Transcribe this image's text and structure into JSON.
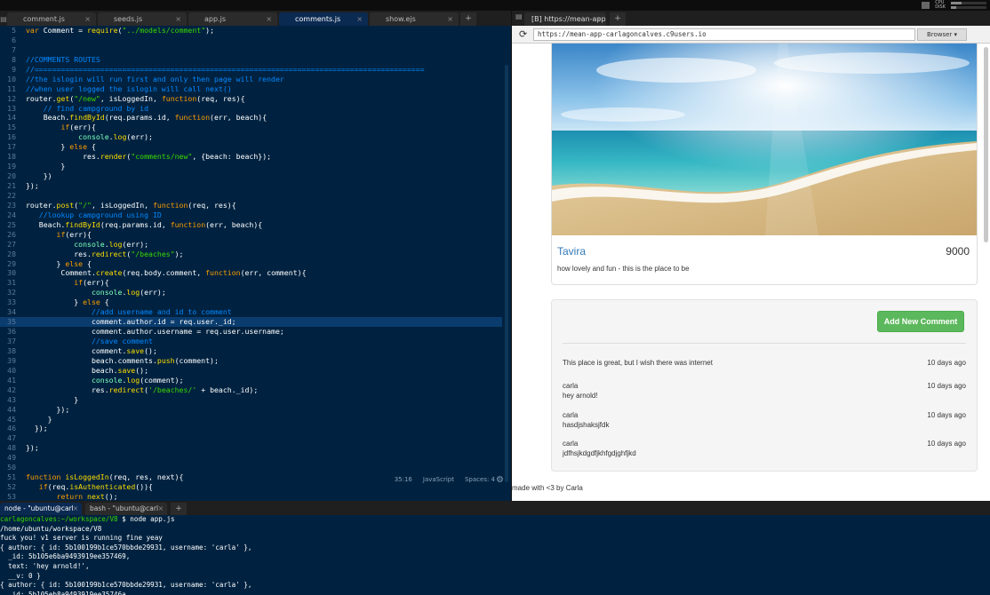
{
  "editor": {
    "tabs": [
      {
        "label": "comment.js",
        "active": false
      },
      {
        "label": "seeds.js",
        "active": false
      },
      {
        "label": "app.js",
        "active": false
      },
      {
        "label": "comments.js",
        "active": true
      },
      {
        "label": "show.ejs",
        "active": false
      }
    ],
    "add_tab": "+",
    "close_glyph": "×",
    "lines": [
      {
        "n": "5",
        "html": "<span class='kw'>var</span> Comment = <span class='fn'>require</span>(<span class='str'>\"../models/comment\"</span>);"
      },
      {
        "n": "6",
        "html": ""
      },
      {
        "n": "7",
        "html": ""
      },
      {
        "n": "8",
        "html": "<span class='cmt'>//COMMENTS ROUTES</span>"
      },
      {
        "n": "9",
        "html": "<span class='cmt'>//=========================================================================================</span>"
      },
      {
        "n": "10",
        "html": "<span class='cmt'>//the islogin will run first and only then page will render</span>"
      },
      {
        "n": "11",
        "html": "<span class='cmt'>//when user logged the islogin will call next()</span>"
      },
      {
        "n": "12",
        "html": "router.<span class='fn'>get</span>(<span class='str'>\"/new\"</span>, isLoggedIn, <span class='kw'>function</span>(req, res){"
      },
      {
        "n": "13",
        "html": "    <span class='cmt'>// find campground by id</span>"
      },
      {
        "n": "14",
        "html": "    Beach.<span class='fn'>findById</span>(req.params.id, <span class='kw'>function</span>(err, beach){"
      },
      {
        "n": "15",
        "html": "        <span class='kw'>if</span>(err){"
      },
      {
        "n": "16",
        "html": "            <span class='obj'>console</span>.<span class='fn'>log</span>(err);"
      },
      {
        "n": "17",
        "html": "        } <span class='kw'>else</span> {"
      },
      {
        "n": "18",
        "html": "             res.<span class='fn'>render</span>(<span class='str'>\"comments/new\"</span>, {beach: beach});"
      },
      {
        "n": "19",
        "html": "        }"
      },
      {
        "n": "20",
        "html": "    })"
      },
      {
        "n": "21",
        "html": "});"
      },
      {
        "n": "22",
        "html": ""
      },
      {
        "n": "23",
        "html": "router.<span class='fn'>post</span>(<span class='str'>\"/\"</span>, isLoggedIn, <span class='kw'>function</span>(req, res){"
      },
      {
        "n": "24",
        "html": "   <span class='cmt'>//lookup campground using ID</span>"
      },
      {
        "n": "25",
        "html": "   Beach.<span class='fn'>findById</span>(req.params.id, <span class='kw'>function</span>(err, beach){"
      },
      {
        "n": "26",
        "html": "       <span class='kw'>if</span>(err){"
      },
      {
        "n": "27",
        "html": "           <span class='obj'>console</span>.<span class='fn'>log</span>(err);"
      },
      {
        "n": "28",
        "html": "           res.<span class='fn'>redirect</span>(<span class='str'>\"/beaches\"</span>);"
      },
      {
        "n": "29",
        "html": "       } <span class='kw'>else</span> {"
      },
      {
        "n": "30",
        "html": "        Comment.<span class='fn'>create</span>(req.body.comment, <span class='kw'>function</span>(err, comment){"
      },
      {
        "n": "31",
        "html": "           <span class='kw'>if</span>(err){"
      },
      {
        "n": "32",
        "html": "               <span class='obj'>console</span>.<span class='fn'>log</span>(err);"
      },
      {
        "n": "33",
        "html": "           } <span class='kw'>else</span> {"
      },
      {
        "n": "34",
        "html": "               <span class='cmt'>//add username and id to comment</span>"
      },
      {
        "n": "35",
        "html": "               comment.author.id = req.user._id;"
      },
      {
        "n": "36",
        "html": "               comment.author.username = req.user.username;"
      },
      {
        "n": "37",
        "html": "               <span class='cmt'>//save comment</span>"
      },
      {
        "n": "38",
        "html": "               comment.<span class='fn'>save</span>();"
      },
      {
        "n": "39",
        "html": "               beach.comments.<span class='fn'>push</span>(comment);"
      },
      {
        "n": "40",
        "html": "               beach.<span class='fn'>save</span>();"
      },
      {
        "n": "41",
        "html": "               <span class='obj'>console</span>.<span class='fn'>log</span>(comment);"
      },
      {
        "n": "42",
        "html": "               res.<span class='fn'>redirect</span>(<span class='str'>'/beaches/'</span> + beach._id);"
      },
      {
        "n": "43",
        "html": "           }"
      },
      {
        "n": "44",
        "html": "       });"
      },
      {
        "n": "45",
        "html": "     }"
      },
      {
        "n": "46",
        "html": "  });"
      },
      {
        "n": "47",
        "html": ""
      },
      {
        "n": "48",
        "html": "});"
      },
      {
        "n": "49",
        "html": ""
      },
      {
        "n": "50",
        "html": ""
      },
      {
        "n": "51",
        "html": "<span class='kw'>function</span> <span class='fn'>isLoggedIn</span>(req, res, next){"
      },
      {
        "n": "52",
        "html": "   <span class='kw'>if</span>(req.<span class='fn'>isAuthenticated</span>()){"
      },
      {
        "n": "53",
        "html": "       <span class='kw'>return</span> <span class='fn'>next</span>();"
      }
    ],
    "highlight_line": "35",
    "status": {
      "position": "35:16",
      "language": "JavaScript",
      "spaces": "Spaces: 4"
    }
  },
  "browser": {
    "tab_label": "[B] https://mean-app",
    "url": "https://mean-app-carlagoncalves.c9users.io",
    "browser_button": "Browser ▾",
    "reload_icon": "⟳",
    "page": {
      "beach_name": "Tavira",
      "price": "9000",
      "description": "how lovely and fun - this is the place to be",
      "add_comment_label": "Add New Comment",
      "comments": [
        {
          "author": "",
          "text": "This place is great, but I wish there was internet",
          "time": "10 days ago"
        },
        {
          "author": "carla",
          "text": "hey arnold!",
          "time": "10 days ago"
        },
        {
          "author": "carla",
          "text": "hasdjshaksjfdk",
          "time": "10 days ago"
        },
        {
          "author": "carla",
          "text": "jdfhsjkdgdfjkhfgdjghfjkd",
          "time": "10 days ago"
        }
      ],
      "footer": "made with <3 by Carla"
    }
  },
  "terminal": {
    "tabs": [
      {
        "label": "node - \"ubuntu@carl",
        "active": true
      },
      {
        "label": "bash - \"ubuntu@carl",
        "active": false
      }
    ],
    "lines": [
      {
        "prompt": "carlagoncalves:~/workspace/V8",
        "text": " $ node app.js"
      },
      {
        "prompt": "",
        "text": "/home/ubuntu/workspace/V8"
      },
      {
        "prompt": "",
        "text": "fuck you! v1 server is running fine yeay"
      },
      {
        "prompt": "",
        "text": "{ author: { id: 5b100199b1ce570bbde29931, username: 'carla' },"
      },
      {
        "prompt": "",
        "text": "  _id: 5b105e6ba9493919ee357469,"
      },
      {
        "prompt": "",
        "text": "  text: 'hey arnold!',"
      },
      {
        "prompt": "",
        "text": "  __v: 0 }"
      },
      {
        "prompt": "",
        "text": "{ author: { id: 5b100199b1ce570bbde29931, username: 'carla' },"
      },
      {
        "prompt": "",
        "text": "  _id: 5b105eb8a9493919ee35746a,"
      }
    ]
  },
  "system": {
    "cpu_label": "CPU",
    "disk_label": "DISK",
    "cpu_level": 0.3,
    "disk_level": 0.15
  }
}
